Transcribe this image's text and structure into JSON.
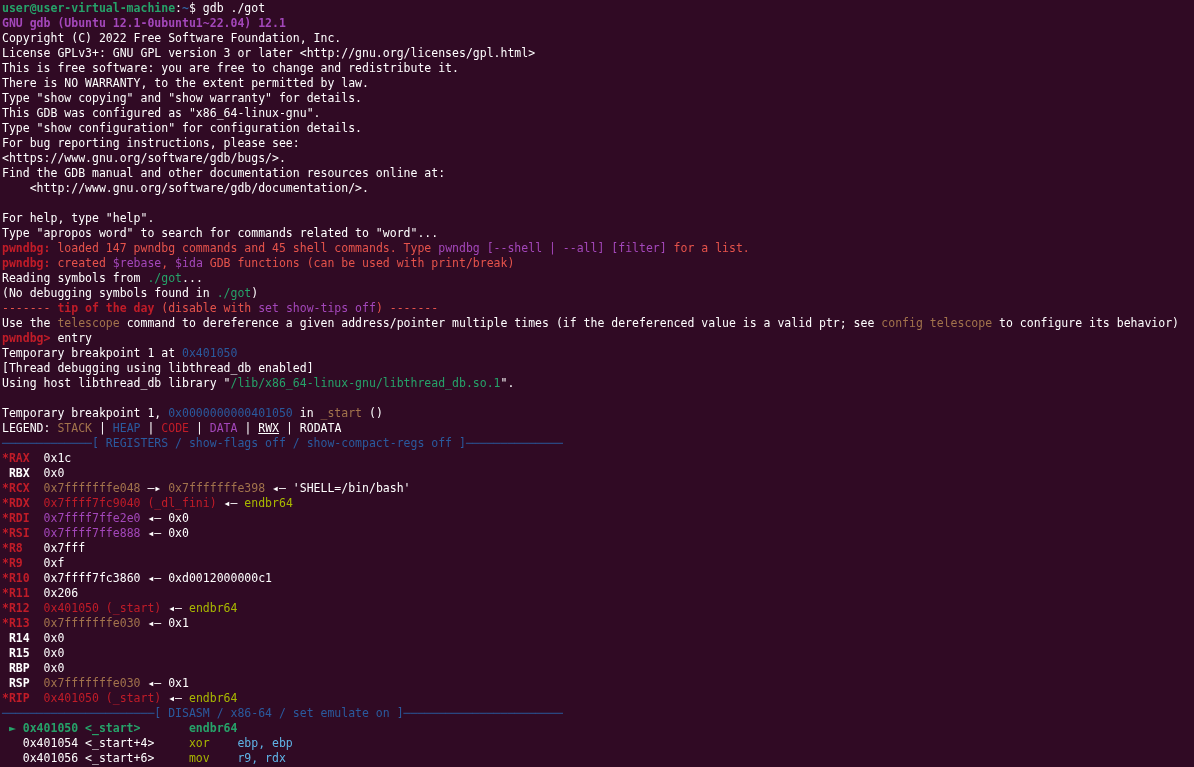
{
  "terminal": {
    "lines": [
      {
        "kind": "text",
        "segments": [
          {
            "text": "user@user-virtual-machine",
            "color": "#26a269",
            "bold": true
          },
          {
            "text": ":"
          },
          {
            "text": "~",
            "color": "#3465a4",
            "bold": true
          },
          {
            "text": "$ gdb ./got"
          }
        ]
      },
      {
        "kind": "text",
        "segments": [
          {
            "text": "GNU gdb (Ubuntu 12.1-0ubuntu1~22.04) 12.1",
            "color": "#a347ba",
            "bold": true
          }
        ]
      },
      {
        "kind": "text",
        "segments": [
          {
            "text": "Copyright (C) 2022 Free Software Foundation, Inc."
          }
        ]
      },
      {
        "kind": "text",
        "segments": [
          {
            "text": "License GPLv3+: GNU GPL version 3 or later <http://gnu.org/licenses/gpl.html>"
          }
        ]
      },
      {
        "kind": "text",
        "segments": [
          {
            "text": "This is free software: you are free to change and redistribute it."
          }
        ]
      },
      {
        "kind": "text",
        "segments": [
          {
            "text": "There is NO WARRANTY, to the extent permitted by law."
          }
        ]
      },
      {
        "kind": "text",
        "segments": [
          {
            "text": "Type \"show copying\" and \"show warranty\" for details."
          }
        ]
      },
      {
        "kind": "text",
        "segments": [
          {
            "text": "This GDB was configured as \"x86_64-linux-gnu\"."
          }
        ]
      },
      {
        "kind": "text",
        "segments": [
          {
            "text": "Type \"show configuration\" for configuration details."
          }
        ]
      },
      {
        "kind": "text",
        "segments": [
          {
            "text": "For bug reporting instructions, please see:"
          }
        ]
      },
      {
        "kind": "text",
        "segments": [
          {
            "text": "<https://www.gnu.org/software/gdb/bugs/>."
          }
        ]
      },
      {
        "kind": "text",
        "segments": [
          {
            "text": "Find the GDB manual and other documentation resources online at:"
          }
        ]
      },
      {
        "kind": "text",
        "segments": [
          {
            "text": "    <http://www.gnu.org/software/gdb/documentation/>."
          }
        ]
      },
      {
        "kind": "blank"
      },
      {
        "kind": "text",
        "segments": [
          {
            "text": "For help, type \"help\"."
          }
        ]
      },
      {
        "kind": "text",
        "segments": [
          {
            "text": "Type \"apropos word\" to search for commands related to \"word\"..."
          }
        ]
      },
      {
        "kind": "text",
        "segments": [
          {
            "text": "pwndbg:",
            "color": "#c01c28",
            "bold": true
          },
          {
            "text": " loaded 147 pwndbg commands and 45 shell commands. Type ",
            "color": "#e5534b"
          },
          {
            "text": "pwndbg [--shell | --all] [filter]",
            "color": "#a347ba"
          },
          {
            "text": " for a list.",
            "color": "#e5534b"
          }
        ]
      },
      {
        "kind": "text",
        "color": "#e5534b",
        "segments": [
          {
            "text": "pwndbg:",
            "color": "#c01c28",
            "bold": true
          },
          {
            "text": " created "
          },
          {
            "text": "$rebase",
            "color": "#a347ba"
          },
          {
            "text": ", "
          },
          {
            "text": "$ida",
            "color": "#a347ba"
          },
          {
            "text": " GDB functions (can be used with print/break)"
          }
        ]
      },
      {
        "kind": "text",
        "segments": [
          {
            "text": "Reading symbols from "
          },
          {
            "text": "./got",
            "color": "#26a269"
          },
          {
            "text": "..."
          }
        ]
      },
      {
        "kind": "text",
        "segments": [
          {
            "text": "(No debugging symbols found in "
          },
          {
            "text": "./got",
            "color": "#26a269"
          },
          {
            "text": ")"
          }
        ]
      },
      {
        "kind": "text",
        "segments": [
          {
            "text": "------- ",
            "color": "#e5534b"
          },
          {
            "text": "tip of the day",
            "color": "#c01c28",
            "bold": true
          },
          {
            "text": " (disable with ",
            "color": "#e5534b"
          },
          {
            "text": "set show-tips off",
            "color": "#a347ba"
          },
          {
            "text": ") -------",
            "color": "#e5534b"
          }
        ]
      },
      {
        "kind": "text",
        "segments": [
          {
            "text": "Use the "
          },
          {
            "text": "telescope",
            "color": "#a2734c"
          },
          {
            "text": " command to dereference a given address/pointer multiple times (if the dereferenced value is a valid ptr; see "
          },
          {
            "text": "config telescope",
            "color": "#a2734c"
          },
          {
            "text": " to configure its behavior)"
          }
        ]
      },
      {
        "kind": "text",
        "segments": [
          {
            "text": "pwndbg>",
            "color": "#c01c28",
            "bold": true
          },
          {
            "text": " entry"
          }
        ]
      },
      {
        "kind": "text",
        "segments": [
          {
            "text": "Temporary breakpoint 1 at "
          },
          {
            "text": "0x401050",
            "color": "#2a5a9e"
          }
        ]
      },
      {
        "kind": "text",
        "segments": [
          {
            "text": "[Thread debugging using libthread_db enabled]"
          }
        ]
      },
      {
        "kind": "text",
        "segments": [
          {
            "text": "Using host libthread_db library \""
          },
          {
            "text": "/lib/x86_64-linux-gnu/libthread_db.so.1",
            "color": "#26a269"
          },
          {
            "text": "\"."
          }
        ]
      },
      {
        "kind": "blank"
      },
      {
        "kind": "text",
        "segments": [
          {
            "text": "Temporary breakpoint 1, "
          },
          {
            "text": "0x0000000000401050",
            "color": "#2a5a9e"
          },
          {
            "text": " in "
          },
          {
            "text": "_start",
            "color": "#a2734c"
          },
          {
            "text": " ()"
          }
        ]
      },
      {
        "kind": "text",
        "segments": [
          {
            "text": "LEGEND: "
          },
          {
            "text": "STACK",
            "color": "#a2734c"
          },
          {
            "text": " | "
          },
          {
            "text": "HEAP",
            "color": "#2a5a9e"
          },
          {
            "text": " | "
          },
          {
            "text": "CODE",
            "color": "#c01c28"
          },
          {
            "text": " | "
          },
          {
            "text": "DATA",
            "color": "#a347ba"
          },
          {
            "text": " | "
          },
          {
            "text": "RWX",
            "underline": true
          },
          {
            "text": " | RODATA"
          }
        ]
      },
      {
        "kind": "header",
        "segments": [
          {
            "text": "─────────────[ REGISTERS / show-flags off / show-compact-regs off ]──────────────",
            "color": "#2a5a9e"
          }
        ]
      },
      {
        "kind": "text",
        "segments": [
          {
            "text": "*RAX",
            "color": "#c01c28",
            "bold": true
          },
          {
            "text": "  0x1c"
          }
        ]
      },
      {
        "kind": "text",
        "segments": [
          {
            "text": " RBX",
            "bold": true
          },
          {
            "text": "  0x0"
          }
        ]
      },
      {
        "kind": "text",
        "segments": [
          {
            "text": "*RCX  ",
            "color": "#c01c28",
            "bold": true
          },
          {
            "text": "0x7fffffffe048",
            "color": "#a2734c"
          },
          {
            "text": " —▸ "
          },
          {
            "text": "0x7fffffffe398",
            "color": "#a2734c"
          },
          {
            "text": " ◂— 'SHELL=/bin/bash'"
          }
        ]
      },
      {
        "kind": "text",
        "segments": [
          {
            "text": "*RDX  ",
            "color": "#c01c28",
            "bold": true
          },
          {
            "text": "0x7ffff7fc9040 (_dl_fini)",
            "color": "#c01c28"
          },
          {
            "text": " ◂— "
          },
          {
            "text": "endbr64",
            "color": "#a8b800"
          }
        ]
      },
      {
        "kind": "text",
        "segments": [
          {
            "text": "*RDI  ",
            "color": "#c01c28",
            "bold": true
          },
          {
            "text": "0x7ffff7ffe2e0",
            "color": "#a347ba"
          },
          {
            "text": " ◂— 0x0"
          }
        ]
      },
      {
        "kind": "text",
        "segments": [
          {
            "text": "*RSI  ",
            "color": "#c01c28",
            "bold": true
          },
          {
            "text": "0x7ffff7ffe888",
            "color": "#a347ba"
          },
          {
            "text": " ◂— 0x0"
          }
        ]
      },
      {
        "kind": "text",
        "segments": [
          {
            "text": "*R8",
            "color": "#c01c28",
            "bold": true
          },
          {
            "text": "   0x7fff"
          }
        ]
      },
      {
        "kind": "text",
        "segments": [
          {
            "text": "*R9",
            "color": "#c01c28",
            "bold": true
          },
          {
            "text": "   0xf"
          }
        ]
      },
      {
        "kind": "text",
        "segments": [
          {
            "text": "*R10",
            "color": "#c01c28",
            "bold": true
          },
          {
            "text": "  0x7ffff7fc3860 ◂— 0xd0012000000c1"
          }
        ]
      },
      {
        "kind": "text",
        "segments": [
          {
            "text": "*R11",
            "color": "#c01c28",
            "bold": true
          },
          {
            "text": "  0x206"
          }
        ]
      },
      {
        "kind": "text",
        "segments": [
          {
            "text": "*R12  ",
            "color": "#c01c28",
            "bold": true
          },
          {
            "text": "0x401050 (_start)",
            "color": "#c01c28"
          },
          {
            "text": " ◂— "
          },
          {
            "text": "endbr64",
            "color": "#a8b800"
          }
        ]
      },
      {
        "kind": "text",
        "segments": [
          {
            "text": "*R13  ",
            "color": "#c01c28",
            "bold": true
          },
          {
            "text": "0x7fffffffe030",
            "color": "#a2734c"
          },
          {
            "text": " ◂— 0x1"
          }
        ]
      },
      {
        "kind": "text",
        "segments": [
          {
            "text": " R14",
            "bold": true
          },
          {
            "text": "  0x0"
          }
        ]
      },
      {
        "kind": "text",
        "segments": [
          {
            "text": " R15",
            "bold": true
          },
          {
            "text": "  0x0"
          }
        ]
      },
      {
        "kind": "text",
        "segments": [
          {
            "text": " RBP",
            "bold": true
          },
          {
            "text": "  0x0"
          }
        ]
      },
      {
        "kind": "text",
        "segments": [
          {
            "text": " RSP  ",
            "bold": true
          },
          {
            "text": "0x7fffffffe030",
            "color": "#a2734c"
          },
          {
            "text": " ◂— 0x1"
          }
        ]
      },
      {
        "kind": "text",
        "segments": [
          {
            "text": "*RIP  ",
            "color": "#c01c28",
            "bold": true
          },
          {
            "text": "0x401050 (_start)",
            "color": "#c01c28"
          },
          {
            "text": " ◂— "
          },
          {
            "text": "endbr64",
            "color": "#a8b800"
          }
        ]
      },
      {
        "kind": "header",
        "segments": [
          {
            "text": "──────────────────────[ DISASM / x86-64 / set emulate on ]───────────────────────",
            "color": "#2a5a9e"
          }
        ]
      },
      {
        "kind": "text",
        "segments": [
          {
            "text": " ► 0x401050 <_start>       endbr64",
            "color": "#26a269",
            "bold": true
          }
        ]
      },
      {
        "kind": "text",
        "segments": [
          {
            "text": "   0x401054 <_start+4>     "
          },
          {
            "text": "xor    ",
            "color": "#a8b800"
          },
          {
            "text": "ebp, ebp",
            "color": "#5fb3e6"
          }
        ]
      },
      {
        "kind": "text",
        "segments": [
          {
            "text": "   0x401056 <_start+6>     "
          },
          {
            "text": "mov    ",
            "color": "#a8b800"
          },
          {
            "text": "r9, rdx",
            "color": "#5fb3e6"
          }
        ]
      }
    ]
  }
}
